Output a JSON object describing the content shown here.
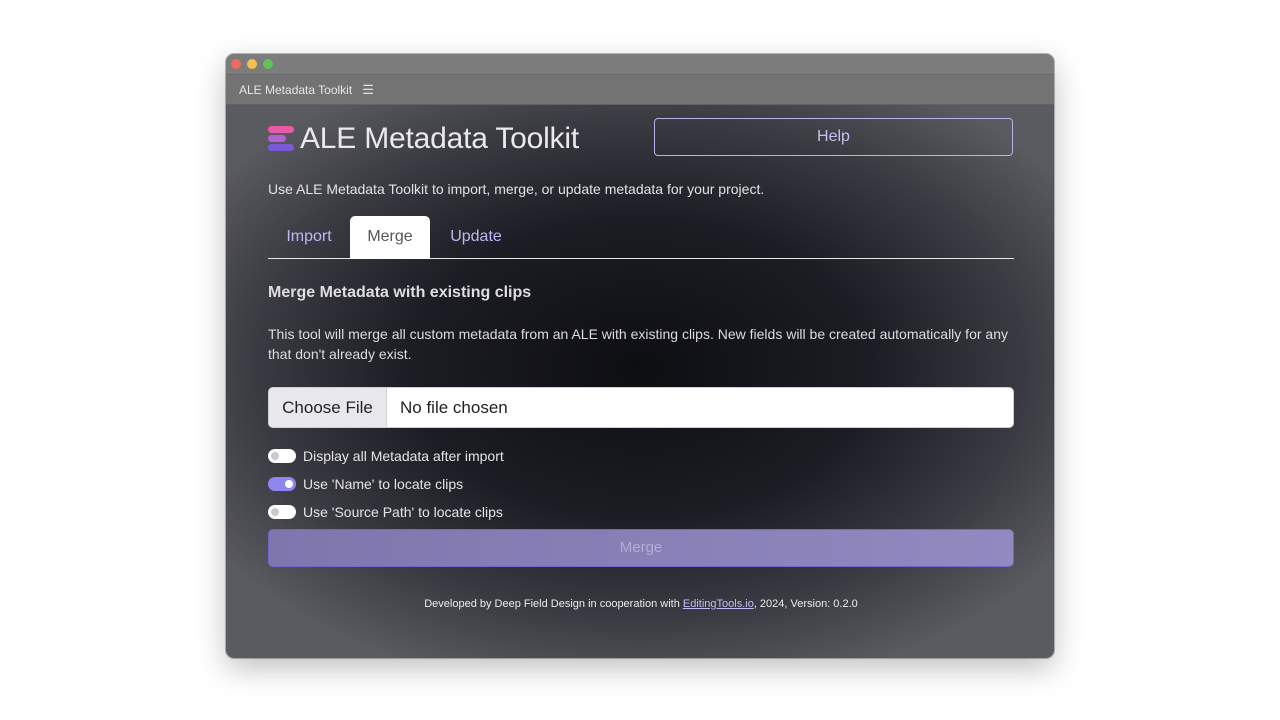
{
  "window": {
    "panel_title": "ALE Metadata Toolkit",
    "menu_icon": "hamburger-menu-icon"
  },
  "header": {
    "logo_icon": "stacked-bars-logo-icon",
    "app_title": "ALE Metadata Toolkit",
    "help_label": "Help"
  },
  "intro": "Use ALE Metadata Toolkit to import, merge, or update metadata for your project.",
  "tabs": [
    {
      "label": "Import",
      "active": false
    },
    {
      "label": "Merge",
      "active": true
    },
    {
      "label": "Update",
      "active": false
    }
  ],
  "merge_panel": {
    "title": "Merge Metadata with existing clips",
    "description": "This tool will merge all custom metadata from an ALE with existing clips. New fields will be created automatically for any that don't already exist.",
    "file_input": {
      "button_label": "Choose File",
      "status": "No file chosen"
    },
    "options": [
      {
        "label": "Display all Metadata after import",
        "checked": false
      },
      {
        "label": "Use 'Name' to locate clips",
        "checked": true
      },
      {
        "label": "Use 'Source Path' to locate clips",
        "checked": false
      }
    ],
    "submit_label": "Merge"
  },
  "footer": {
    "prefix": "Developed by Deep Field Design in cooperation with ",
    "link_text": "EditingTools.io",
    "suffix": ", 2024, Version: 0.2.0"
  },
  "colors": {
    "accent": "#8f87ef",
    "tab_link": "#bfb7f5",
    "logo_pink": "#e85aa8",
    "logo_purple": "#7b5ad6"
  }
}
